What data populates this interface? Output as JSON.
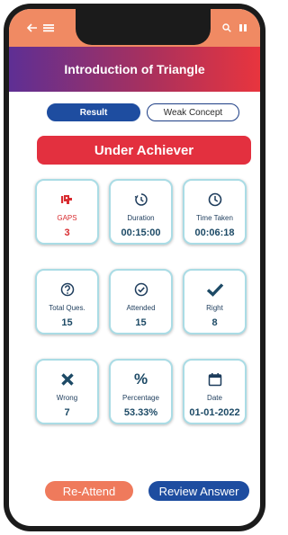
{
  "header": {
    "title": "Introduction of Triangle",
    "left_icons": [
      "back-arrow-icon",
      "menu-icon"
    ],
    "right_icons": [
      "search-icon",
      "pause-icon"
    ]
  },
  "tabs": [
    {
      "label": "Result",
      "active": true
    },
    {
      "label": "Weak Concept",
      "active": false
    }
  ],
  "status_banner": "Under Achiever",
  "stats": [
    {
      "icon": "gaps-icon",
      "label": "GAPS",
      "value": "3"
    },
    {
      "icon": "timer-icon",
      "label": "Duration",
      "value": "00:15:00"
    },
    {
      "icon": "clock-icon",
      "label": "Time Taken",
      "value": "00:06:18"
    },
    {
      "icon": "question-circle-icon",
      "label": "Total Ques.",
      "value": "15"
    },
    {
      "icon": "check-circle-icon",
      "label": "Attended",
      "value": "15"
    },
    {
      "icon": "checkmark-icon",
      "label": "Right",
      "value": "8"
    },
    {
      "icon": "cross-icon",
      "label": "Wrong",
      "value": "7"
    },
    {
      "icon": "percent-icon",
      "label": "Percentage",
      "value": "53.33%"
    },
    {
      "icon": "calendar-icon",
      "label": "Date",
      "value": "01-01-2022"
    }
  ],
  "actions": {
    "reattend_label": "Re-Attend",
    "review_label": "Review Answer"
  },
  "colors": {
    "accent_blue": "#1e4da0",
    "danger_red": "#e3303f",
    "orange": "#f08a63",
    "card_border": "#aadce5"
  }
}
